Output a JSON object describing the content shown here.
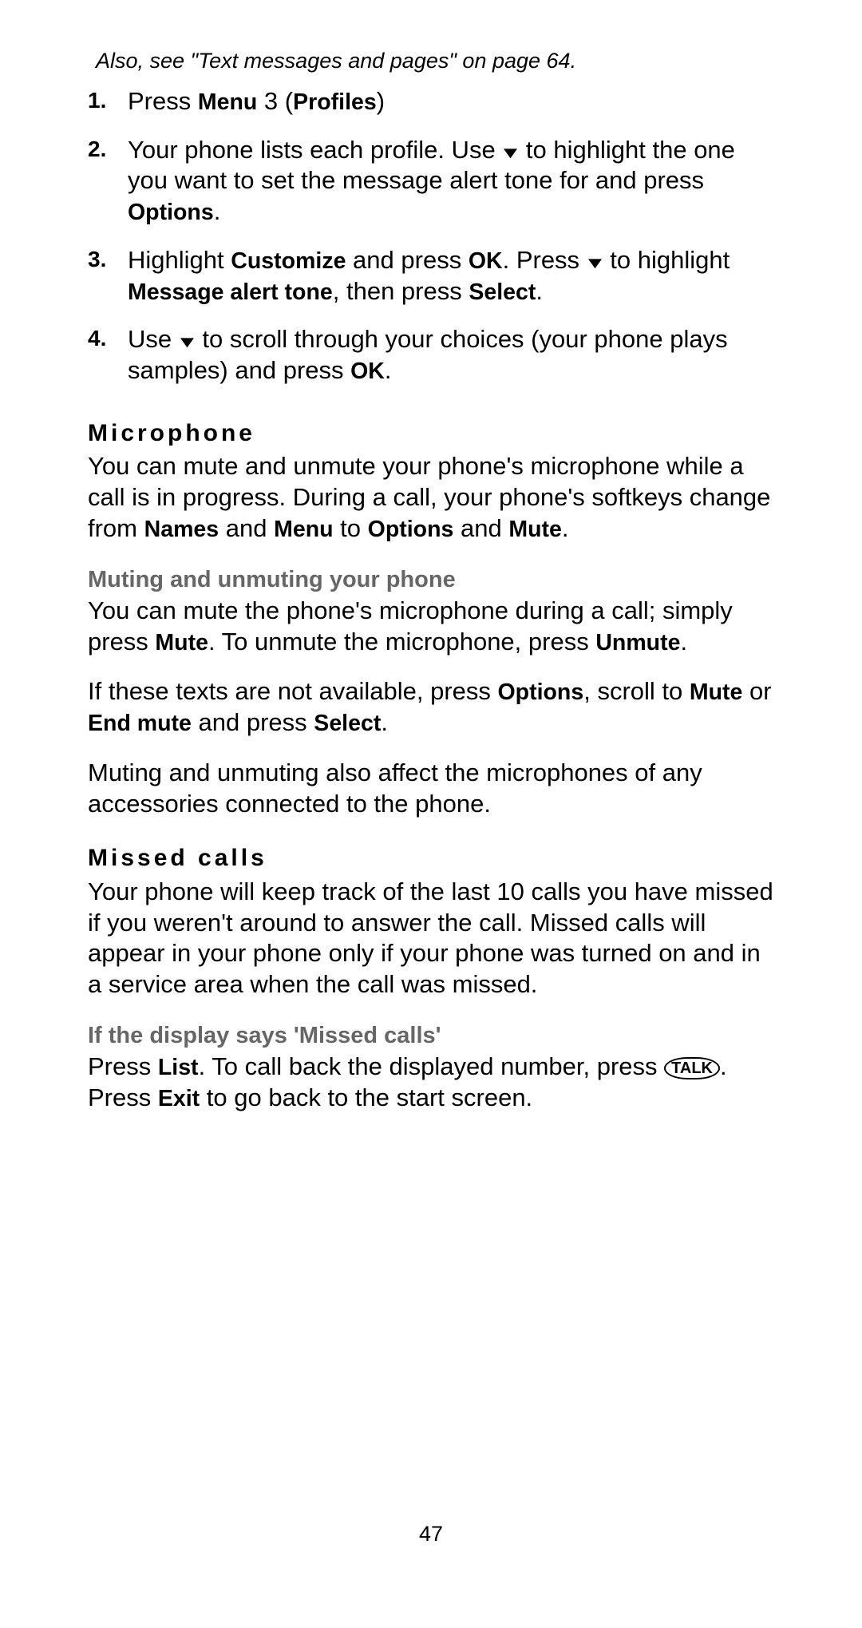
{
  "note": "Also, see \"Text messages and pages\" on page 64.",
  "steps": [
    {
      "num": "1.",
      "parts": [
        "Press ",
        {
          "b": "Menu"
        },
        " 3 (",
        {
          "b": "Profiles"
        },
        ")"
      ]
    },
    {
      "num": "2.",
      "parts": [
        "Your phone lists each profile. Use ",
        {
          "arrow": true
        },
        " to highlight the one you want to set the message alert tone for and press ",
        {
          "b": "Options"
        },
        "."
      ]
    },
    {
      "num": "3.",
      "parts": [
        "Highlight ",
        {
          "b": "Customize"
        },
        " and press ",
        {
          "b": "OK"
        },
        ". Press ",
        {
          "arrow": true
        },
        " to highlight ",
        {
          "b": "Message alert tone"
        },
        ", then press ",
        {
          "b": "Select"
        },
        "."
      ]
    },
    {
      "num": "4.",
      "parts": [
        "Use ",
        {
          "arrow": true
        },
        " to scroll through your choices (your phone plays samples) and press ",
        {
          "b": "OK"
        },
        "."
      ]
    }
  ],
  "microphone": {
    "heading": "Microphone",
    "body_parts": [
      "You can mute and unmute your phone's microphone while a call is in progress. During a call, your phone's softkeys change from ",
      {
        "b": "Names"
      },
      " and ",
      {
        "b": "Menu"
      },
      " to ",
      {
        "b": "Options"
      },
      " and ",
      {
        "b": "Mute"
      },
      "."
    ]
  },
  "muting": {
    "heading": "Muting and unmuting your phone",
    "p1_parts": [
      "You can mute the phone's microphone during a call; simply press ",
      {
        "b": "Mute"
      },
      ". To unmute the microphone, press ",
      {
        "b": "Unmute"
      },
      "."
    ],
    "p2_parts": [
      "If these texts are not available, press ",
      {
        "b": "Options"
      },
      ", scroll to ",
      {
        "b": "Mute"
      },
      " or ",
      {
        "b": "End mute"
      },
      " and press ",
      {
        "b": "Select"
      },
      "."
    ],
    "p3": "Muting and unmuting also affect the microphones of any accessories connected to the phone."
  },
  "missed": {
    "heading": "Missed calls",
    "body": "Your phone will keep track of the last 10 calls you have missed if you weren't around to answer the call. Missed calls will appear in your phone only if your phone was turned on and in a service area when the call was missed."
  },
  "ifdisplay": {
    "heading": "If the display says 'Missed calls'",
    "body_parts": [
      "Press ",
      {
        "b": "List"
      },
      ". To call back the displayed number, press ",
      {
        "talk": "TALK"
      },
      ". Press ",
      {
        "b": "Exit"
      },
      " to go back to the start screen."
    ]
  },
  "page_number": "47"
}
